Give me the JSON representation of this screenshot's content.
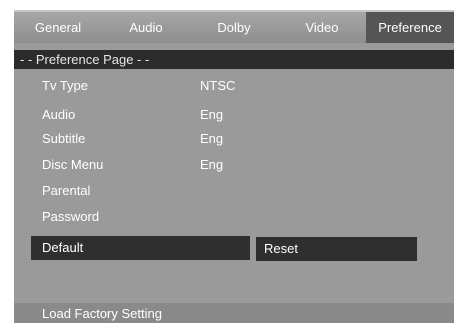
{
  "tabs": [
    {
      "label": "General"
    },
    {
      "label": "Audio"
    },
    {
      "label": "Dolby"
    },
    {
      "label": "Video"
    },
    {
      "label": "Preference"
    }
  ],
  "page_header": "- -  Preference  Page  - -",
  "settings": [
    {
      "label": "Tv Type",
      "value": "NTSC"
    },
    {
      "label": "Audio",
      "value": "Eng"
    },
    {
      "label": "Subtitle",
      "value": "Eng"
    },
    {
      "label": "Disc Menu",
      "value": "Eng"
    },
    {
      "label": "Parental",
      "value": ""
    },
    {
      "label": "Password",
      "value": ""
    },
    {
      "label": "Default",
      "value": ""
    }
  ],
  "submenu": {
    "option": "Reset"
  },
  "status": "Load  Factory  Setting"
}
